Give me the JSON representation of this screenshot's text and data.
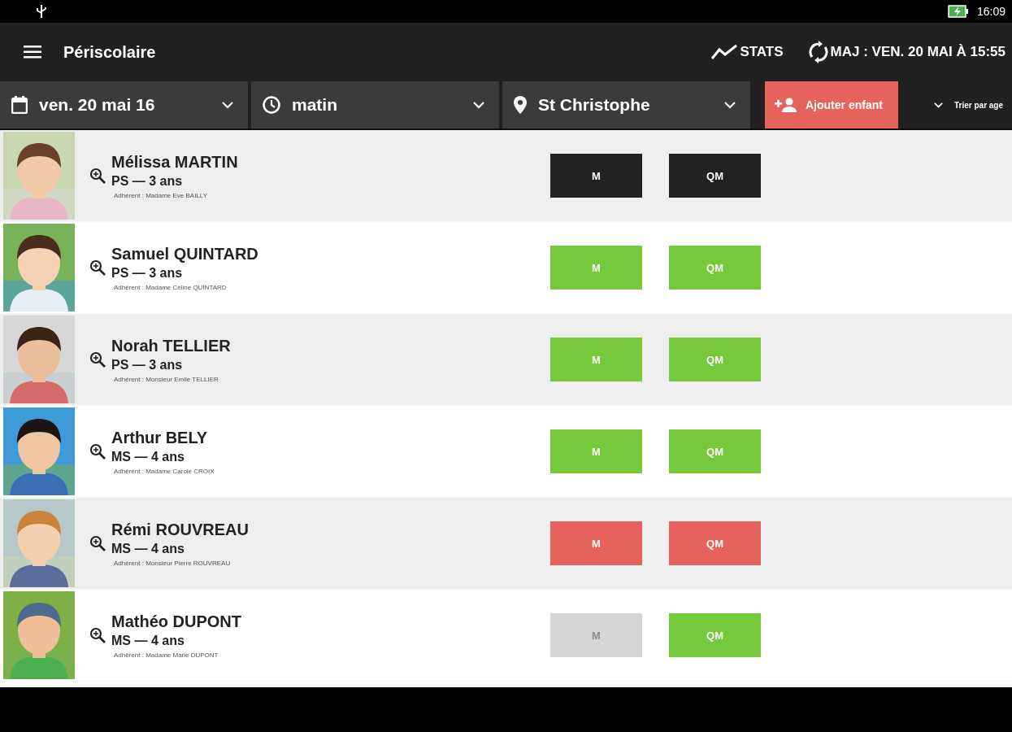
{
  "status_bar": {
    "time": "16:09"
  },
  "app_bar": {
    "title": "Périscolaire",
    "stats": "STATS",
    "update": "MAJ : VEN. 20 MAI À 15:55"
  },
  "filters": [
    {
      "kind": "date",
      "value": "ven. 20 mai 16"
    },
    {
      "kind": "time",
      "value": "matin"
    },
    {
      "kind": "place",
      "value": "St Christophe"
    }
  ],
  "add_button": "Ajouter enfant",
  "sort": "Trier par age",
  "children": [
    {
      "name": "Mélissa MARTIN",
      "level_age": "PS — 3 ans",
      "member": "Adhérent : Madame Eve BAILLY",
      "buttons": [
        {
          "label": "M",
          "color": "#222222",
          "disabled": false
        },
        {
          "label": "QM",
          "color": "#222222",
          "disabled": false
        }
      ]
    },
    {
      "name": "Samuel QUINTARD",
      "level_age": "PS — 3 ans",
      "member": "Adhérent : Madame Céline QUINTARD",
      "buttons": [
        {
          "label": "M",
          "color": "#76c93a",
          "disabled": false
        },
        {
          "label": "QM",
          "color": "#76c93a",
          "disabled": false
        }
      ]
    },
    {
      "name": "Norah TELLIER",
      "level_age": "PS — 3 ans",
      "member": "Adhérent : Monsieur Emile TELLIER",
      "buttons": [
        {
          "label": "M",
          "color": "#76c93a",
          "disabled": false
        },
        {
          "label": "QM",
          "color": "#76c93a",
          "disabled": false
        }
      ]
    },
    {
      "name": "Arthur BELY",
      "level_age": "MS — 4 ans",
      "member": "Adhérent : Madame Carole CROIX",
      "buttons": [
        {
          "label": "M",
          "color": "#76c93a",
          "disabled": false
        },
        {
          "label": "QM",
          "color": "#76c93a",
          "disabled": false
        }
      ]
    },
    {
      "name": "Rémi ROUVREAU",
      "level_age": "MS — 4 ans",
      "member": "Adhérent : Monsieur Pierre ROUVREAU",
      "buttons": [
        {
          "label": "M",
          "color": "#e5635c",
          "disabled": false
        },
        {
          "label": "QM",
          "color": "#e5635c",
          "disabled": false
        }
      ]
    },
    {
      "name": "Mathéo DUPONT",
      "level_age": "MS — 4 ans",
      "member": "Adhérent : Madame Marie DUPONT",
      "buttons": [
        {
          "label": "M",
          "color": "#d6d6d6",
          "disabled": true
        },
        {
          "label": "QM",
          "color": "#76c93a",
          "disabled": false
        }
      ]
    }
  ]
}
